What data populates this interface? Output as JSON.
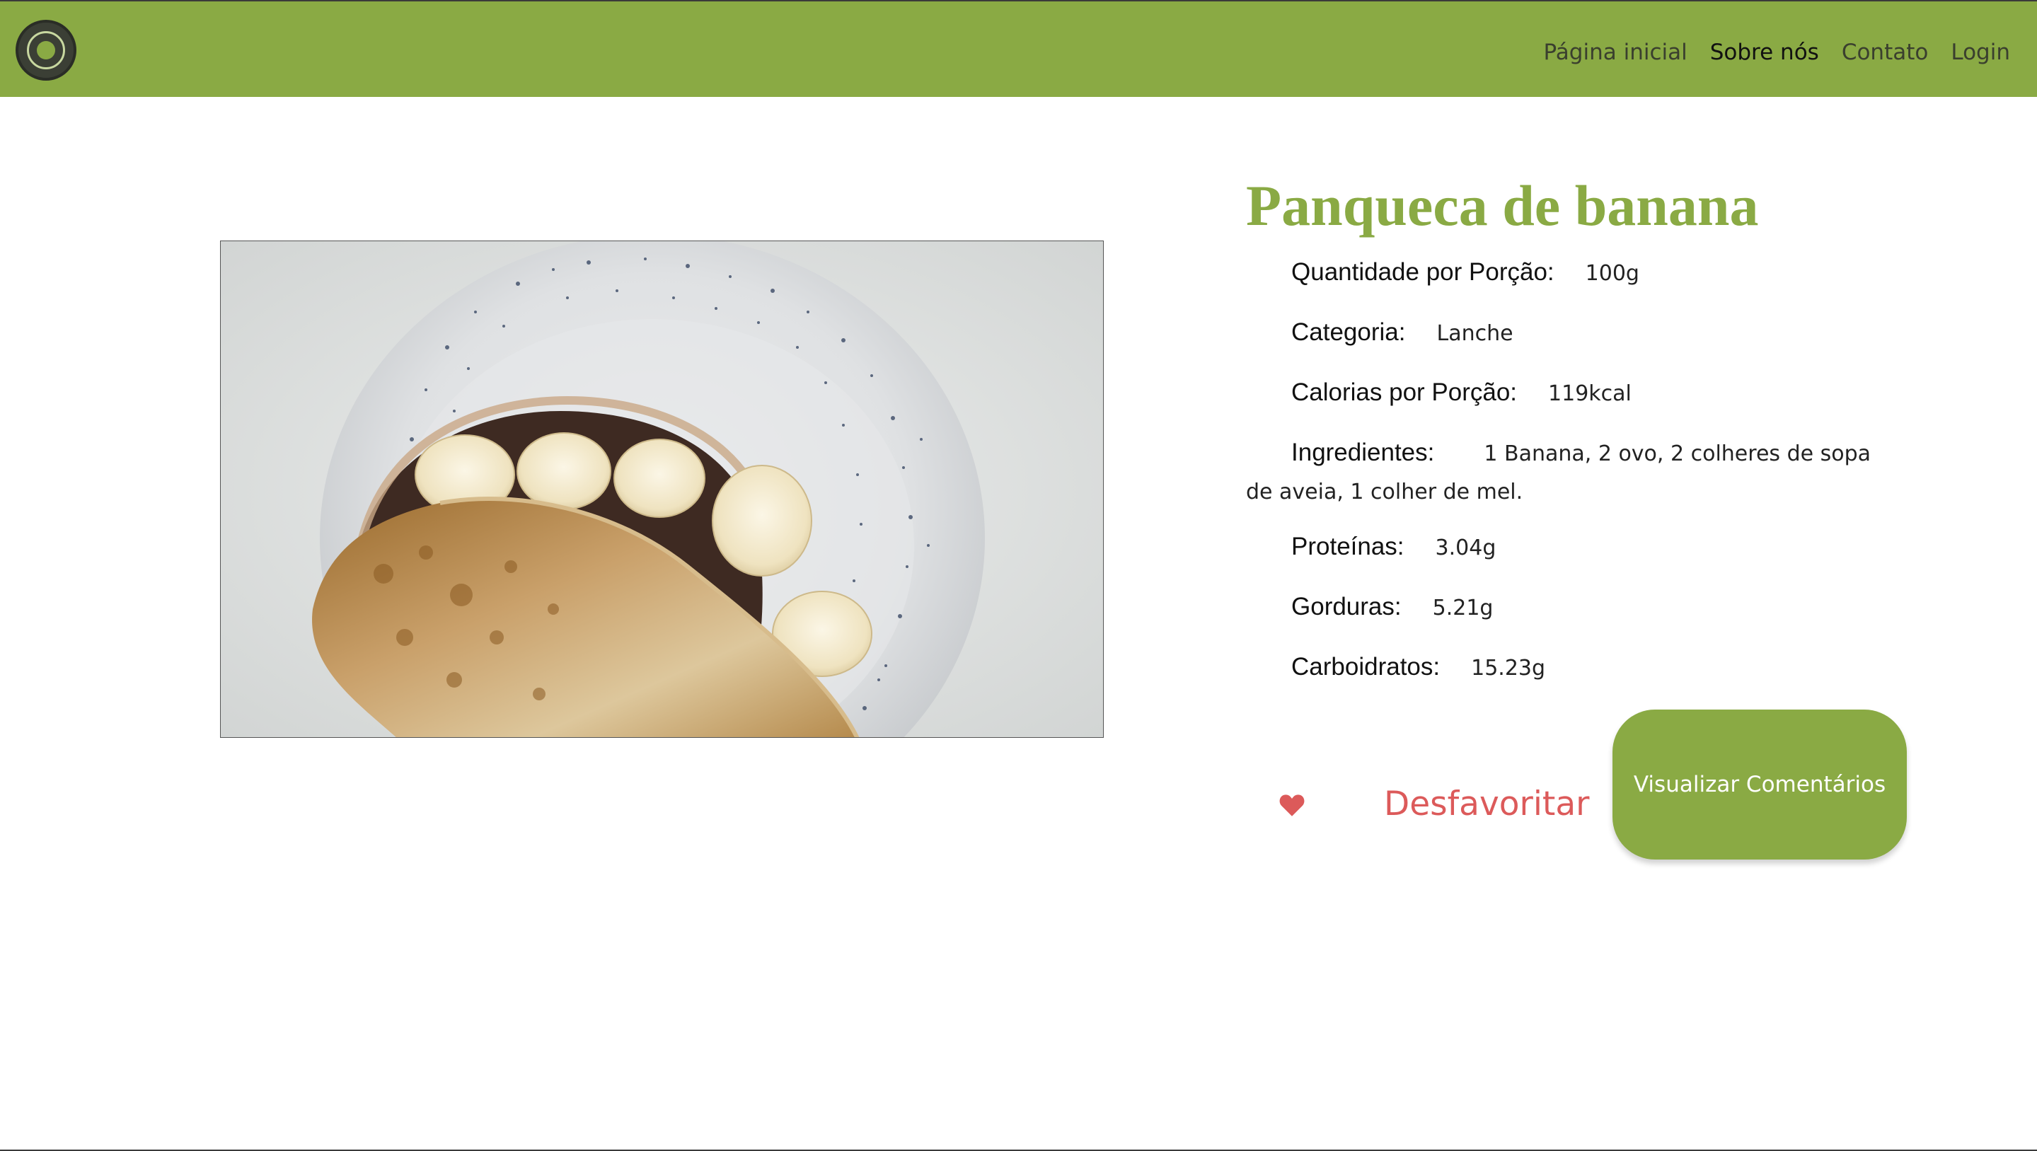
{
  "navbar": {
    "logo_alt": "Fit Food logo",
    "links": [
      {
        "label": "Página inicial",
        "active": false
      },
      {
        "label": "Sobre nós",
        "active": true
      },
      {
        "label": "Contato",
        "active": false
      },
      {
        "label": "Login",
        "active": false
      }
    ]
  },
  "recipe": {
    "title": "Panqueca de banana",
    "image_desc": "banana-pancake-photo",
    "portion": {
      "label": "Quantidade por Porção:",
      "value": "100g"
    },
    "category": {
      "label": "Categoria:",
      "value": "Lanche"
    },
    "calories": {
      "label": "Calorias por Porção:",
      "value": "119kcal"
    },
    "ingredients": {
      "label": "Ingredientes:",
      "value": "1 Banana, 2 ovo, 2 colheres de sopa de aveia, 1 colher de mel."
    },
    "protein": {
      "label": "Proteínas:",
      "value": "3.04g"
    },
    "fat": {
      "label": "Gorduras:",
      "value": "5.21g"
    },
    "carbs": {
      "label": "Carboidratos:",
      "value": "15.23g"
    }
  },
  "actions": {
    "unfavorite_label": "Desfavoritar",
    "heart_icon": "heart-icon",
    "comments_label": "Visualizar Comentários"
  },
  "colors": {
    "brand_green": "#8aaa44",
    "favorite_red": "#dc5a5a"
  }
}
